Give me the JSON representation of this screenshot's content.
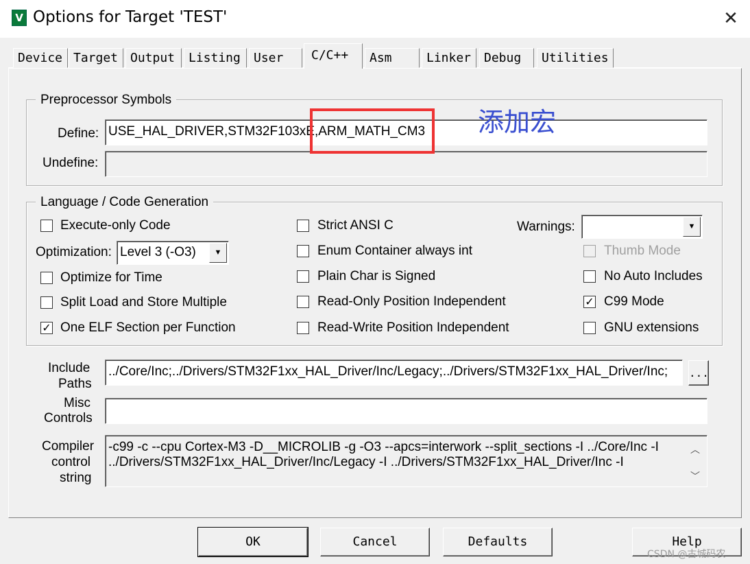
{
  "window": {
    "title": "Options for Target 'TEST'",
    "close_glyph": "✕",
    "app_icon_glyph": "V"
  },
  "tabs": [
    {
      "label": "Device"
    },
    {
      "label": "Target"
    },
    {
      "label": "Output"
    },
    {
      "label": "Listing"
    },
    {
      "label": "User"
    },
    {
      "label": "C/C++",
      "active": true
    },
    {
      "label": "Asm"
    },
    {
      "label": "Linker"
    },
    {
      "label": "Debug"
    },
    {
      "label": "Utilities"
    }
  ],
  "preprocessor": {
    "legend": "Preprocessor Symbols",
    "define_label": "Define:",
    "define_value": "USE_HAL_DRIVER,STM32F103xE,ARM_MATH_CM3",
    "undefine_label": "Undefine:",
    "undefine_value": ""
  },
  "annotation": {
    "text": "添加宏",
    "color": "#3a4fd0",
    "box_color": "#ee3333"
  },
  "language": {
    "legend": "Language / Code Generation",
    "execute_only": "Execute-only Code",
    "optimization_label": "Optimization:",
    "optimization_value": "Level 3 (-O3)",
    "optimize_time": "Optimize for Time",
    "split_load": "Split Load and Store Multiple",
    "one_elf": "One ELF Section per Function",
    "strict_ansi": "Strict ANSI C",
    "enum_container": "Enum Container always int",
    "plain_char": "Plain Char is Signed",
    "ro_pi": "Read-Only Position Independent",
    "rw_pi": "Read-Write Position Independent",
    "warnings_label": "Warnings:",
    "warnings_value": "",
    "thumb_mode": "Thumb Mode",
    "no_auto_includes": "No Auto Includes",
    "c99_mode": "C99 Mode",
    "gnu_ext": "GNU extensions",
    "checked": {
      "one_elf": true,
      "c99_mode": true
    }
  },
  "include": {
    "label_line1": "Include",
    "label_line2": "Paths",
    "value": "../Core/Inc;../Drivers/STM32F1xx_HAL_Driver/Inc/Legacy;../Drivers/STM32F1xx_HAL_Driver/Inc;",
    "browse_label": "..."
  },
  "misc": {
    "label_line1": "Misc",
    "label_line2": "Controls",
    "value": ""
  },
  "compiler": {
    "label_line1": "Compiler",
    "label_line2": "control",
    "label_line3": "string",
    "line1": "-c99 -c --cpu Cortex-M3 -D__MICROLIB -g -O3 --apcs=interwork --split_sections -I ../Core/Inc -I",
    "line2": "../Drivers/STM32F1xx_HAL_Driver/Inc/Legacy -I ../Drivers/STM32F1xx_HAL_Driver/Inc -I"
  },
  "buttons": {
    "ok": "OK",
    "cancel": "Cancel",
    "defaults": "Defaults",
    "help": "Help"
  },
  "watermark": "CSDN @古城码农"
}
